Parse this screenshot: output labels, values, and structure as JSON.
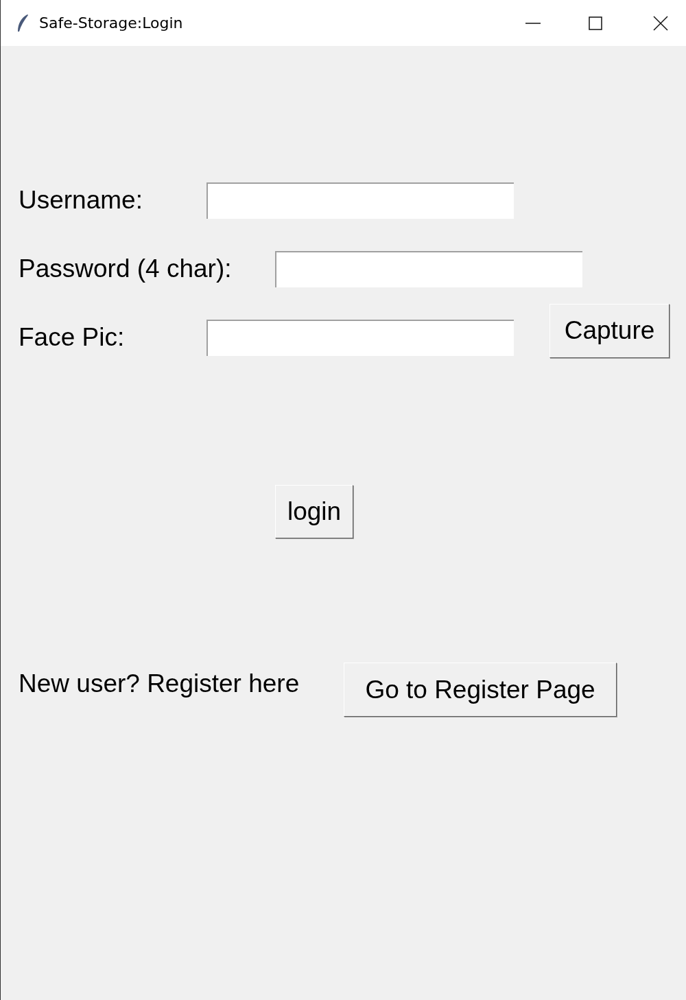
{
  "window": {
    "title": "Safe-Storage:Login"
  },
  "fields": [
    {
      "label": "Username:"
    },
    {
      "label": "Password (4 char):"
    },
    {
      "label": "Face Pic:"
    }
  ],
  "capture_button": "Capture",
  "login_button": "login",
  "register": {
    "text": "New user? Register here",
    "button": "Go to Register Page"
  }
}
